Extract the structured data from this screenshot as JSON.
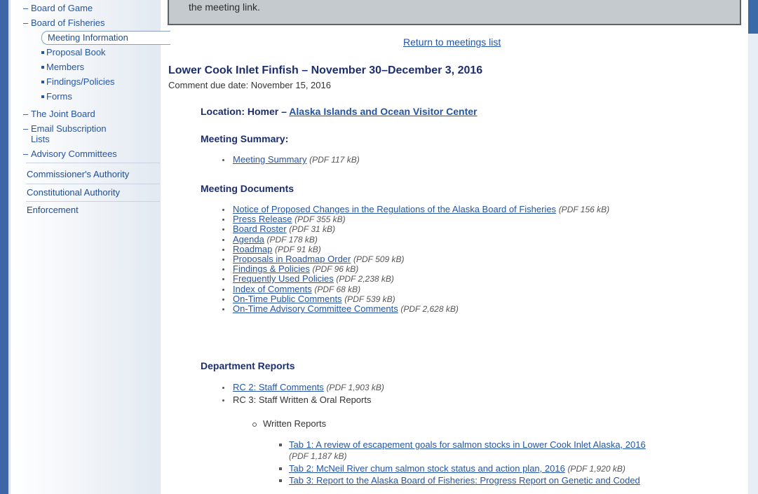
{
  "sidebar": {
    "items": [
      {
        "label": "Board of Game",
        "type": "dash"
      },
      {
        "label": "Board of Fisheries",
        "type": "dash"
      },
      {
        "label": "Meeting Information",
        "type": "active"
      },
      {
        "label": "Proposal Book",
        "type": "bullet"
      },
      {
        "label": "Members",
        "type": "bullet"
      },
      {
        "label": "Findings/Policies",
        "type": "bullet"
      },
      {
        "label": "Forms",
        "type": "bullet"
      },
      {
        "label": "The Joint Board",
        "type": "dash"
      },
      {
        "label": "Email Subscription",
        "type": "dash"
      },
      {
        "label": "Lists",
        "type": "cont"
      },
      {
        "label": "Advisory Committees",
        "type": "dash"
      }
    ],
    "top_links": [
      "Commissioner's Authority",
      "Constitutional Authority",
      "Enforcement"
    ]
  },
  "notice": {
    "text": "the meeting link."
  },
  "return_link": "Return to meetings list",
  "meeting": {
    "title": "Lower Cook Inlet Finfish – November 30–December 3, 2016",
    "comment_due": "Comment due date: November 15, 2016",
    "location_prefix": "Location: Homer – ",
    "location_link": "Alaska Islands and Ocean Visitor Center"
  },
  "summary": {
    "heading": "Meeting Summary:",
    "items": [
      {
        "label": "Meeting Summary",
        "size": "(PDF 117 kB)"
      }
    ]
  },
  "documents": {
    "heading": "Meeting Documents",
    "items": [
      {
        "label": "Notice of Proposed Changes in the Regulations of the Alaska Board of Fisheries",
        "size": "(PDF 156 kB)"
      },
      {
        "label": "Press Release",
        "size": "(PDF 355 kB)"
      },
      {
        "label": "Board Roster",
        "size": "(PDF 31 kB)"
      },
      {
        "label": "Agenda",
        "size": "(PDF 178 kB)"
      },
      {
        "label": "Roadmap",
        "size": "(PDF 91 kB)"
      },
      {
        "label": "Proposals in Roadmap Order",
        "size": "(PDF 509 kB)"
      },
      {
        "label": "Findings & Policies",
        "size": "(PDF 96 kB)"
      },
      {
        "label": "Frequently Used Policies",
        "size": "(PDF 2,238 kB)"
      },
      {
        "label": "Index of Comments",
        "size": "(PDF 68 kB)"
      },
      {
        "label": "On-Time Public Comments",
        "size": "(PDF 539 kB)"
      },
      {
        "label": "On-Time Advisory Committee Comments",
        "size": "(PDF 2,628 kB)"
      }
    ]
  },
  "reports": {
    "heading": "Department Reports",
    "rc2": {
      "label": "RC 2: Staff Comments",
      "size": "(PDF 1,903 kB)"
    },
    "rc3": "RC 3: Staff Written & Oral Reports",
    "written": "Written Reports",
    "tabs": [
      {
        "label": "Tab 1: A review of escapement goals for salmon stocks in Lower Cook Inlet Alaska, 2016",
        "size": "(PDF 1,187 kB)"
      },
      {
        "label": "Tab 2: McNeil River chum salmon stock status and action plan, 2016",
        "size": "(PDF 1,920 kB)"
      },
      {
        "label": "Tab 3: Report to the Alaska Board of Fisheries: Progress Report on Genetic and Coded",
        "size": ""
      }
    ]
  }
}
